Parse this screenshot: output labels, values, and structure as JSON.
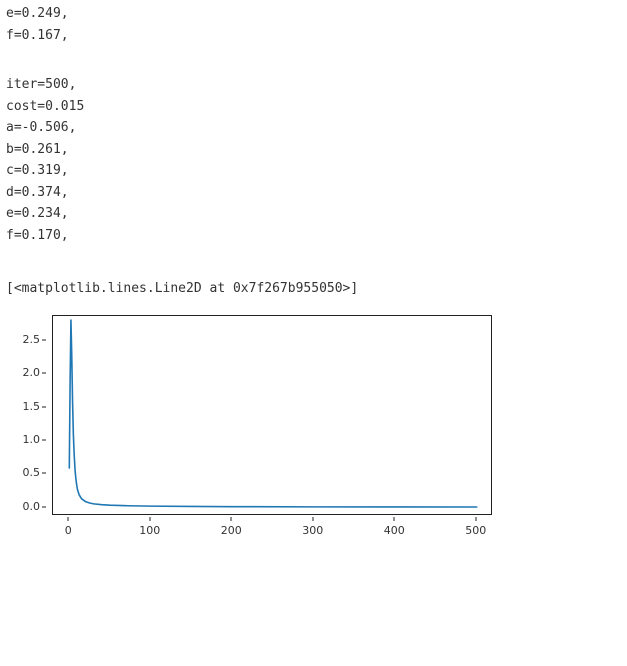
{
  "output_block1": [
    "e=0.249,",
    "f=0.167,"
  ],
  "output_block2": [
    "iter=500,",
    "cost=0.015",
    "a=-0.506,",
    "b=0.261,",
    "c=0.319,",
    "d=0.374,",
    "e=0.234,",
    "f=0.170,"
  ],
  "repr_text": "[<matplotlib.lines.Line2D at 0x7f267b955050>]",
  "chart_data": {
    "type": "line",
    "title": "",
    "xlabel": "",
    "ylabel": "",
    "xlim": [
      -20,
      520
    ],
    "ylim": [
      -0.12,
      2.88
    ],
    "x_ticks": [
      0,
      100,
      200,
      300,
      400,
      500
    ],
    "y_ticks": [
      0.0,
      0.5,
      1.0,
      1.5,
      2.0,
      2.5
    ],
    "series": [
      {
        "name": "cost",
        "color": "#1f77b4",
        "x": [
          0,
          1,
          2,
          3,
          4,
          5,
          6,
          7,
          8,
          9,
          10,
          12,
          15,
          20,
          25,
          30,
          40,
          50,
          70,
          100,
          150,
          200,
          300,
          400,
          500
        ],
        "y": [
          0.6,
          1.9,
          2.82,
          2.3,
          1.6,
          1.1,
          0.8,
          0.58,
          0.45,
          0.35,
          0.28,
          0.2,
          0.14,
          0.095,
          0.075,
          0.062,
          0.05,
          0.042,
          0.034,
          0.028,
          0.023,
          0.02,
          0.017,
          0.016,
          0.015
        ]
      }
    ]
  }
}
